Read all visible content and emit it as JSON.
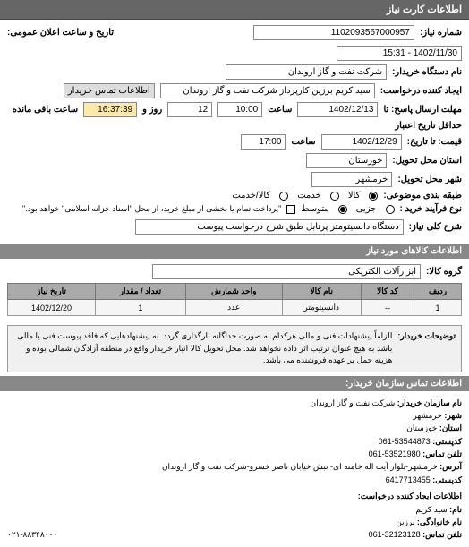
{
  "header": {
    "title": "اطلاعات کارت نیاز"
  },
  "form": {
    "request_no_label": "شماره نیاز:",
    "request_no": "1102093567000957",
    "public_datetime_label": "تاریخ و ساعت اعلان عمومی:",
    "public_datetime": "1402/11/30 - 15:31",
    "buyer_label": "نام دستگاه خریدار:",
    "buyer": "شرکت نفت و گاز اروندان",
    "creator_label": "ایجاد کننده درخواست:",
    "creator": "سید کریم برزین کارپرداز شرکت نفت و گاز اروندان",
    "contact_button": "اطلاعات تماس خریدار",
    "deadline_label": "مهلت ارسال پاسخ: تا",
    "deadline_date": "1402/12/13",
    "deadline_time_label": "ساعت",
    "deadline_time": "10:00",
    "days_remain": "12",
    "days_label": "روز و",
    "hours_remain": "16:37:39",
    "hours_label": "ساعت باقی مانده",
    "credit_label": "حداقل تاریخ اعتبار",
    "price_until_label": "قیمت: تا تاریخ:",
    "price_until_date": "1402/12/29",
    "price_until_time_label": "ساعت",
    "price_until_time": "17:00",
    "delivery_province_label": "استان محل تحویل:",
    "delivery_province": "خوزستان",
    "delivery_city_label": "شهر محل تحویل:",
    "delivery_city": "خرمشهر",
    "subject_class_label": "طبقه بندی موضوعی:",
    "radio_goods": "کالا",
    "radio_service": "خدمت",
    "radio_both": "کالا/خدمت",
    "purchase_type_label": "نوع فرآیند خرید :",
    "radio_small": "جزیی",
    "radio_medium": "متوسط",
    "payment_note": "\"پرداخت تمام یا بخشی از مبلغ خرید، از محل \"اسناد خزانه اسلامی\" خواهد بود.\"",
    "desc_label": "شرح کلی نیاز:",
    "desc": "دستگاه دانسیتومتر پرتابل طبق شرح درخواست پیوست"
  },
  "goods": {
    "header": "اطلاعات کالاهای مورد نیاز",
    "group_label": "گروه کالا:",
    "group": "ابزارآلات الکتریکی",
    "columns": {
      "row": "ردیف",
      "code": "کد کالا",
      "name": "نام کالا",
      "unit": "واحد شمارش",
      "qty": "تعداد / مقدار",
      "date": "تاریخ نیاز"
    },
    "rows": [
      {
        "row": "1",
        "code": "--",
        "name": "دانسیتومتر",
        "unit": "عدد",
        "qty": "1",
        "date": "1402/12/20"
      }
    ]
  },
  "note": {
    "label": "توضیحات خریدار:",
    "text": "الزاماً پیشنهادات فنی و مالی هرکدام به صورت جداگانه بارگذاری گردد. به پیشنهادهایی که فاقد پیوست فنی یا مالی باشد به هیچ عنوان ترتیب اثر داده نخواهد شد. محل تحویل کالا انبار خریدار واقع در منطقه آزادگان شمالی بوده و هزینه حمل بر عهده فروشنده می باشد."
  },
  "contact": {
    "header": "اطلاعات تماس سازمان خریدار:",
    "org_label": "نام سازمان خریدار:",
    "org": "شرکت نفت و گاز اروندان",
    "city_label": "شهر:",
    "city": "خرمشهر",
    "province_label": "استان:",
    "province": "خوزستان",
    "postal_label": "کدپستی:",
    "postal": "53544873-061",
    "phone_label": "تلفن تماس:",
    "phone": "53521980-061",
    "address_label": "آدرس:",
    "address": "خرمشهر-بلوار آیت اله خامنه ای- نبش خیابان ناصر خسرو-شرکت نفت و گاز اروندان",
    "postal2_label": "کدپستی:",
    "postal2": "6417713455",
    "creator_header": "اطلاعات ایجاد کننده درخواست:",
    "cname_label": "نام:",
    "cname": "سید کریم",
    "clast_label": "نام خانوادگی:",
    "clast": "برزین",
    "cphone_label": "تلفن تماس:",
    "cphone": "32123128-061",
    "footer_phone": "۰۲۱-۸۸۳۴۸۰۰۰"
  }
}
